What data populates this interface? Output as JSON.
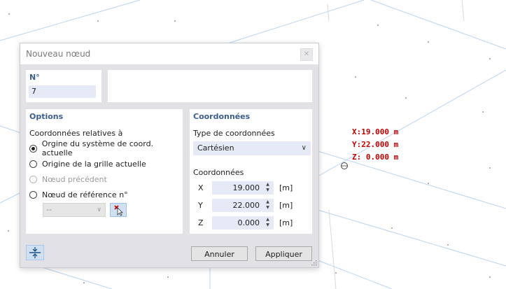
{
  "viewport": {
    "readout": {
      "x": "X:19.000 m",
      "y": "Y:22.000 m",
      "z": "Z: 0.000 m"
    },
    "readout_color": "#c00000",
    "grid_color": "#bcd4ee"
  },
  "dialog": {
    "title": "Nouveau nœud",
    "close_icon": "close-icon",
    "number": {
      "label": "N°",
      "value": "7"
    },
    "options": {
      "title": "Options",
      "relative_label": "Coordonnées relatives à",
      "radios": [
        {
          "label": "Orgine du système de coord. actuelle",
          "checked": true,
          "disabled": false
        },
        {
          "label": "Origine de la grille actuelle",
          "checked": false,
          "disabled": false
        },
        {
          "label": "Nœud précédent",
          "checked": false,
          "disabled": true
        },
        {
          "label": "Nœud de référence n°",
          "checked": false,
          "disabled": false
        }
      ],
      "ref_node_value": "--"
    },
    "coordinates": {
      "title": "Coordonnées",
      "type_label": "Type de coordonnées",
      "type_value": "Cartésien",
      "coords_label": "Coordonnées",
      "rows": [
        {
          "axis": "X",
          "value": "19.000",
          "unit": "[m]"
        },
        {
          "axis": "Y",
          "value": "22.000",
          "unit": "[m]"
        },
        {
          "axis": "Z",
          "value": "0.000",
          "unit": "[m]"
        }
      ]
    },
    "buttons": {
      "cancel": "Annuler",
      "apply": "Appliquer"
    },
    "accent_color": "#3b5d8f"
  }
}
